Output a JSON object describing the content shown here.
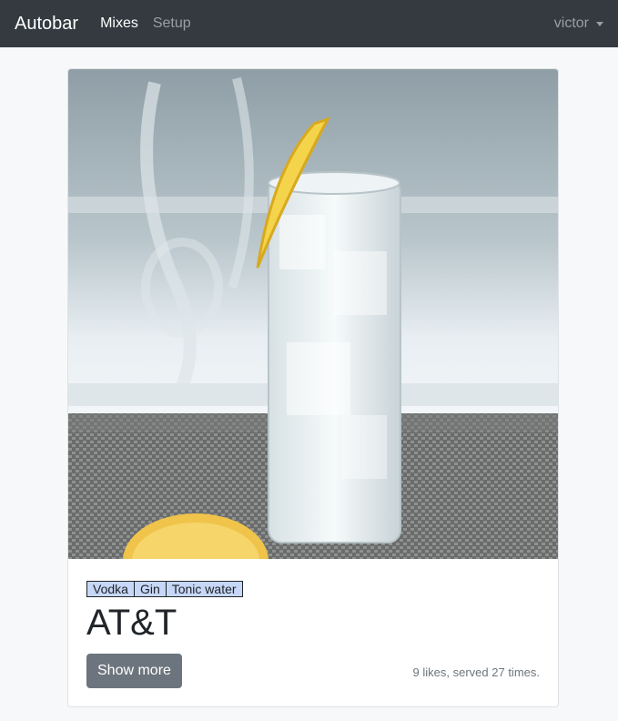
{
  "navbar": {
    "brand": "Autobar",
    "links": [
      {
        "label": "Mixes",
        "active": true
      },
      {
        "label": "Setup",
        "active": false
      }
    ],
    "user": "victor"
  },
  "card": {
    "image_subject": "glass of gin and tonic with lemon slice",
    "tags": [
      "Vodka",
      "Gin",
      "Tonic water"
    ],
    "title": "AT&T",
    "button_label": "Show more",
    "stats": "9 likes, served 27 times."
  }
}
